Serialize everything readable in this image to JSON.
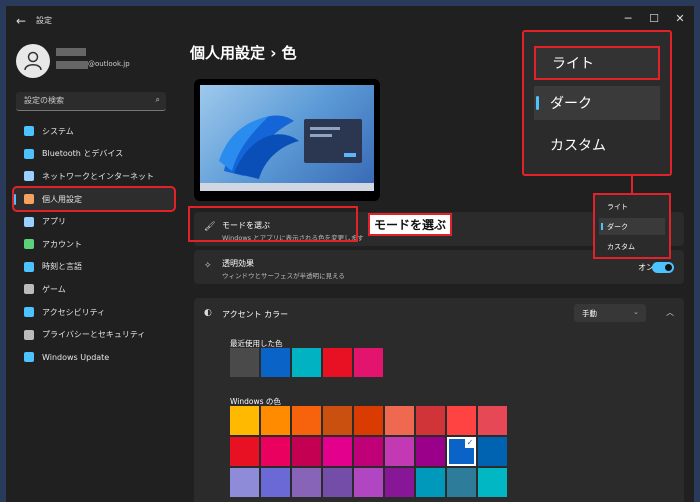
{
  "titlebar": {
    "back_icon": "←",
    "app_title": "設定",
    "minimize": "─",
    "maximize": "☐",
    "close": "✕"
  },
  "account": {
    "email_suffix": "@outlook.jp"
  },
  "search": {
    "placeholder": "設定の検索"
  },
  "sidebar": {
    "items": [
      {
        "label": "システム",
        "icon": "display-icon",
        "color": "#4cc2ff"
      },
      {
        "label": "Bluetooth とデバイス",
        "icon": "bluetooth-icon",
        "color": "#4cc2ff"
      },
      {
        "label": "ネットワークとインターネット",
        "icon": "network-icon",
        "color": "#9ad0ff"
      },
      {
        "label": "個人用設定",
        "icon": "brush-icon",
        "color": "#f4a261"
      },
      {
        "label": "アプリ",
        "icon": "apps-icon",
        "color": "#9ad0ff"
      },
      {
        "label": "アカウント",
        "icon": "account-icon",
        "color": "#5ad17a"
      },
      {
        "label": "時刻と言語",
        "icon": "globe-icon",
        "color": "#4cc2ff"
      },
      {
        "label": "ゲーム",
        "icon": "gamepad-icon",
        "color": "#bbb"
      },
      {
        "label": "アクセシビリティ",
        "icon": "accessibility-icon",
        "color": "#4cc2ff"
      },
      {
        "label": "プライバシーとセキュリティ",
        "icon": "shield-icon",
        "color": "#bbb"
      },
      {
        "label": "Windows Update",
        "icon": "update-icon",
        "color": "#4cc2ff"
      }
    ]
  },
  "main": {
    "title": "個人用設定 › 色",
    "mode": {
      "title": "モードを選ぶ",
      "desc": "Windows とアプリに表示される色を変更します"
    },
    "transparency": {
      "title": "透明効果",
      "desc": "ウィンドウとサーフェスが半透明に見える",
      "state": "オン"
    },
    "accent": {
      "title": "アクセント カラー",
      "value": "手動",
      "recent_label": "最近使用した色",
      "windows_label": "Windows の色"
    }
  },
  "callouts": {
    "mode_label": "モードを選ぶ"
  },
  "mode_options": [
    "ライト",
    "ダーク",
    "カスタム"
  ],
  "colors": {
    "recent": [
      "#4a4a4a",
      "#0a64c8",
      "#00b2c2",
      "#e81123",
      "#e3146e"
    ],
    "windows_rows": [
      [
        "#ffb900",
        "#ff8c00",
        "#f7630c",
        "#ca5010",
        "#da3b01",
        "#ef6950",
        "#d13438",
        "#ff4343",
        "#e74856"
      ],
      [
        "#e81123",
        "#ea005e",
        "#c30052",
        "#e3008c",
        "#bf0077",
        "#c239b3",
        "#9a0089",
        "#0a64c8",
        "#0063b1"
      ],
      [
        "#8e8cd8",
        "#6b69d6",
        "#8764b8",
        "#744da9",
        "#b146c2",
        "#881798",
        "#0099bc",
        "#2d7d9a",
        "#00b7c3"
      ]
    ]
  }
}
